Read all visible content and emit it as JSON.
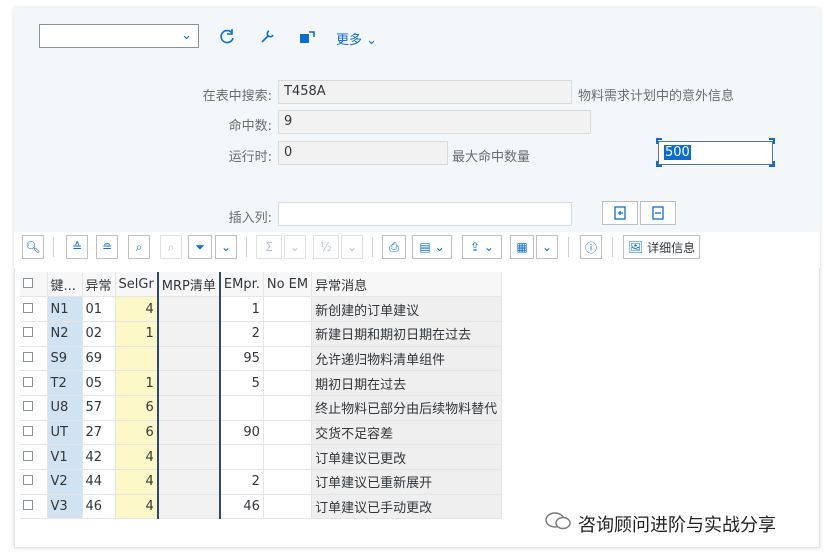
{
  "toolbar": {
    "dropdown_value": "",
    "more_label": "更多"
  },
  "form": {
    "search_label": "在表中搜索:",
    "search_value": "T458A",
    "search_desc": "物料需求计划中的意外信息",
    "hits_label": "命中数:",
    "hits_value": "9",
    "runtime_label": "运行时:",
    "runtime_value": "0",
    "maxhits_label": "最大命中数量",
    "maxhits_value": "500",
    "insert_label": "插入列:",
    "insert_value": ""
  },
  "table_toolbar": {
    "details_label": "详细信息"
  },
  "table": {
    "headers": [
      "键...",
      "异常",
      "SelGr",
      "MRP清单",
      "EMpr.",
      "No EM",
      "异常消息"
    ],
    "rows": [
      {
        "key": "N1",
        "exc": "01",
        "selgr": "4",
        "mrp": "",
        "empr": "1",
        "noem": "",
        "msg": "新创建的订单建议"
      },
      {
        "key": "N2",
        "exc": "02",
        "selgr": "1",
        "mrp": "",
        "empr": "2",
        "noem": "",
        "msg": "新建日期和期初日期在过去"
      },
      {
        "key": "S9",
        "exc": "69",
        "selgr": "",
        "mrp": "",
        "empr": "95",
        "noem": "",
        "msg": "允许递归物料清单组件"
      },
      {
        "key": "T2",
        "exc": "05",
        "selgr": "1",
        "mrp": "",
        "empr": "5",
        "noem": "",
        "msg": "期初日期在过去"
      },
      {
        "key": "U8",
        "exc": "57",
        "selgr": "6",
        "mrp": "",
        "empr": "",
        "noem": "",
        "msg": "终止物料已部分由后续物料替代"
      },
      {
        "key": "UT",
        "exc": "27",
        "selgr": "6",
        "mrp": "",
        "empr": "90",
        "noem": "",
        "msg": "交货不足容差"
      },
      {
        "key": "V1",
        "exc": "42",
        "selgr": "4",
        "mrp": "",
        "empr": "",
        "noem": "",
        "msg": "订单建议已更改"
      },
      {
        "key": "V2",
        "exc": "44",
        "selgr": "4",
        "mrp": "",
        "empr": "2",
        "noem": "",
        "msg": "订单建议已重新展开"
      },
      {
        "key": "V3",
        "exc": "46",
        "selgr": "4",
        "mrp": "",
        "empr": "46",
        "noem": "",
        "msg": "订单建议已手动更改"
      }
    ]
  },
  "watermark": "咨询顾问进阶与实战分享",
  "colors": {
    "accent": "#0a6ed1",
    "key_bg": "#d1e2f3",
    "selgr_bg": "#fdf8c8",
    "highlight_border": "#2c4a6e"
  }
}
